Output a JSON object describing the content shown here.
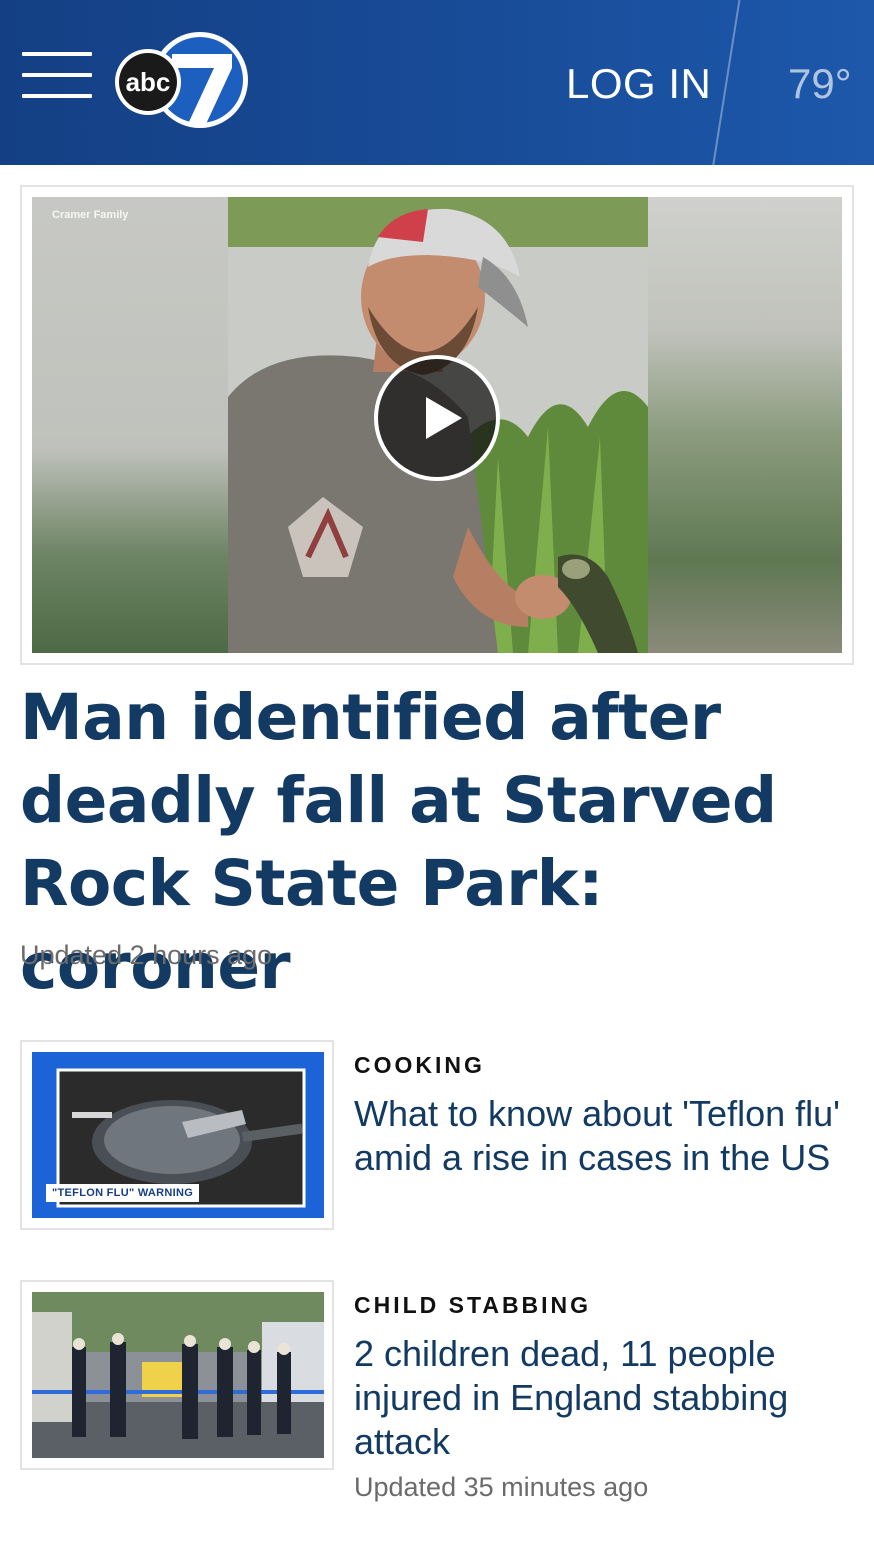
{
  "header": {
    "logo_text": "abc",
    "logo_number": "7",
    "login_label": "LOG IN",
    "temperature": "79°"
  },
  "hero": {
    "photo_credit": "Cramer Family",
    "title": "Man identified after deadly fall at Starved Rock State Park: coroner",
    "timestamp": "Updated 2 hours ago",
    "play_icon": "play-icon"
  },
  "stories": [
    {
      "kicker": "COOKING",
      "title": "What to know about 'Teflon flu' amid a rise in cases in the US",
      "thumb_caption": "\"TEFLON FLU\" WARNING",
      "timestamp": ""
    },
    {
      "kicker": "CHILD STABBING",
      "title": "2 children dead, 11 people injured in England stabbing attack",
      "timestamp": "Updated 35 minutes ago"
    }
  ],
  "colors": {
    "header_bg": "#184c98",
    "headline": "#133a62",
    "meta_text": "#6b6b6b"
  }
}
